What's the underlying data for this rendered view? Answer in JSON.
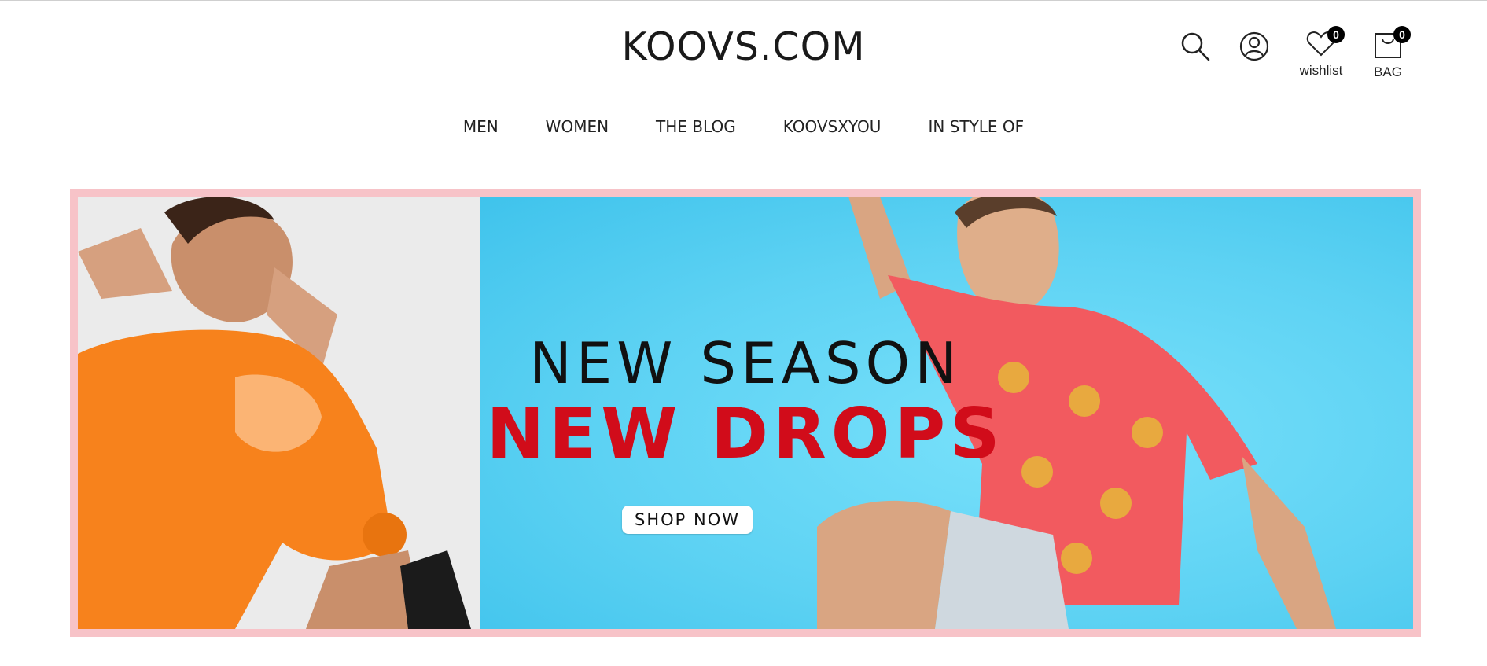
{
  "brand": {
    "logo_text": "KOOVS.COM"
  },
  "header": {
    "wishlist_label": "wishlist",
    "wishlist_count": "0",
    "bag_label": "BAG",
    "bag_count": "0"
  },
  "nav": {
    "items": [
      {
        "label": "MEN"
      },
      {
        "label": "WOMEN"
      },
      {
        "label": "THE BLOG"
      },
      {
        "label": "KOOVSXYOU"
      },
      {
        "label": "IN STYLE OF"
      }
    ]
  },
  "banner": {
    "line1": "NEW SEASON",
    "line2": "NEW DROPS",
    "cta": "SHOP NOW",
    "colors": {
      "border": "#f7c3c8",
      "accent_red": "#d10c1a",
      "sky": "#5fd3f4"
    }
  },
  "icons": [
    "search-icon",
    "user-icon",
    "heart-icon",
    "bag-icon"
  ]
}
